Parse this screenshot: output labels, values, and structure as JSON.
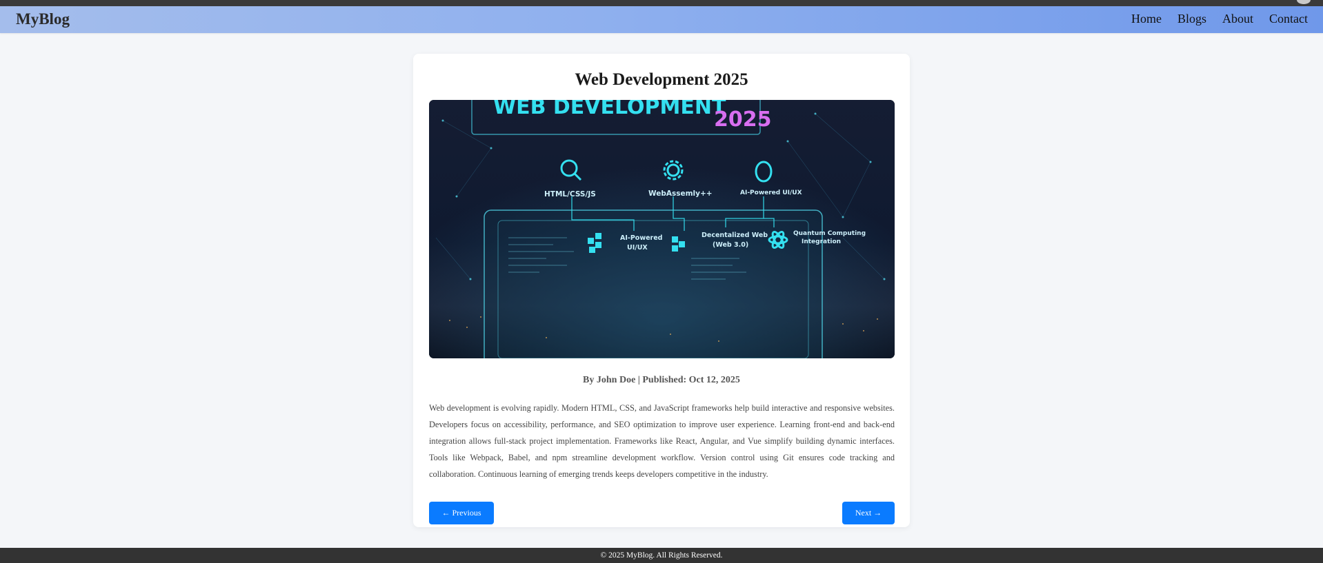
{
  "header": {
    "logo": "MyBlog",
    "nav": [
      "Home",
      "Blogs",
      "About",
      "Contact"
    ]
  },
  "post": {
    "title": "Web Development 2025",
    "image": {
      "headline": "WEB DEVELOPMENT",
      "headline_year": "2025",
      "labels": {
        "html": "HTML/CSS/JS",
        "wasm": "WebAssemly++",
        "ai_top": "AI-Powered UI/UX",
        "ai_mid_1": "AI-Powered",
        "ai_mid_2": "UI/UX",
        "web3_1": "Decentalized Web",
        "web3_2": "(Web 3.0)",
        "quantum_1": "Quantum Computing",
        "quantum_2": "Integration"
      }
    },
    "meta": "By John Doe | Published: Oct 12, 2025",
    "body": "Web development is evolving rapidly. Modern HTML, CSS, and JavaScript frameworks help build interactive and responsive websites. Developers focus on accessibility, performance, and SEO optimization to improve user experience. Learning front-end and back-end integration allows full-stack project implementation. Frameworks like React, Angular, and Vue simplify building dynamic interfaces. Tools like Webpack, Babel, and npm streamline development workflow. Version control using Git ensures code tracking and collaboration. Continuous learning of emerging trends keeps developers competitive in the industry."
  },
  "pagination": {
    "prev": "← Previous",
    "next": "Next →"
  },
  "footer": {
    "text": "© 2025 MyBlog. All Rights Reserved."
  },
  "colors": {
    "accent": "#0a7bff",
    "header_start": "#a4bdec",
    "header_end": "#6f98ea",
    "footer": "#333333"
  }
}
